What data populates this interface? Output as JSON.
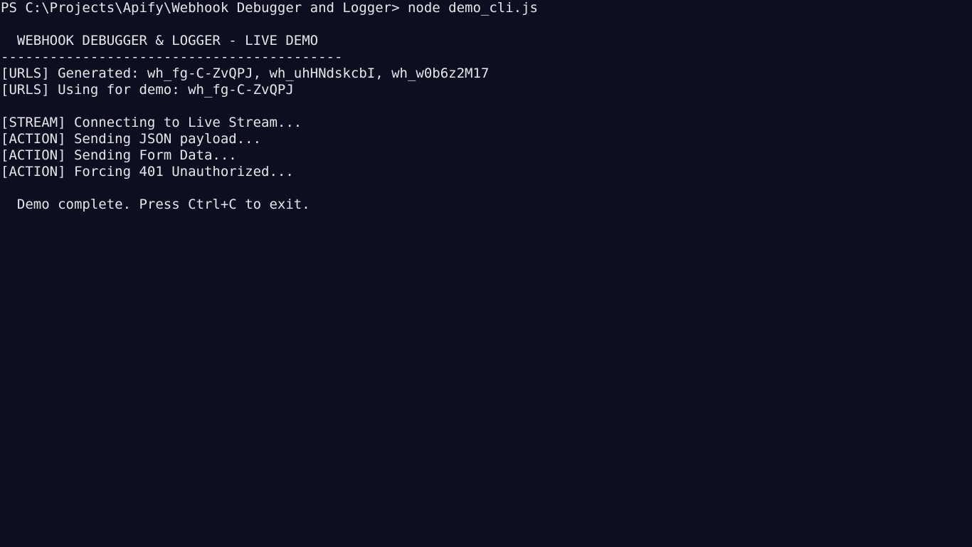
{
  "terminal": {
    "prompt": "PS C:\\Projects\\Apify\\Webhook Debugger and Logger>",
    "command": "node demo_cli.js",
    "lines": [
      "",
      "  WEBHOOK DEBUGGER & LOGGER - LIVE DEMO",
      "------------------------------------------",
      "[URLS] Generated: wh_fg-C-ZvQPJ, wh_uhHNdskcbI, wh_w0b6z2M17",
      "[URLS] Using for demo: wh_fg-C-ZvQPJ",
      "",
      "[STREAM] Connecting to Live Stream...",
      "[ACTION] Sending JSON payload...",
      "[ACTION] Sending Form Data...",
      "[ACTION] Forcing 401 Unauthorized...",
      "",
      "  Demo complete. Press Ctrl+C to exit."
    ]
  },
  "colors": {
    "background": "#0c0f20",
    "foreground": "#e6e6ea"
  }
}
